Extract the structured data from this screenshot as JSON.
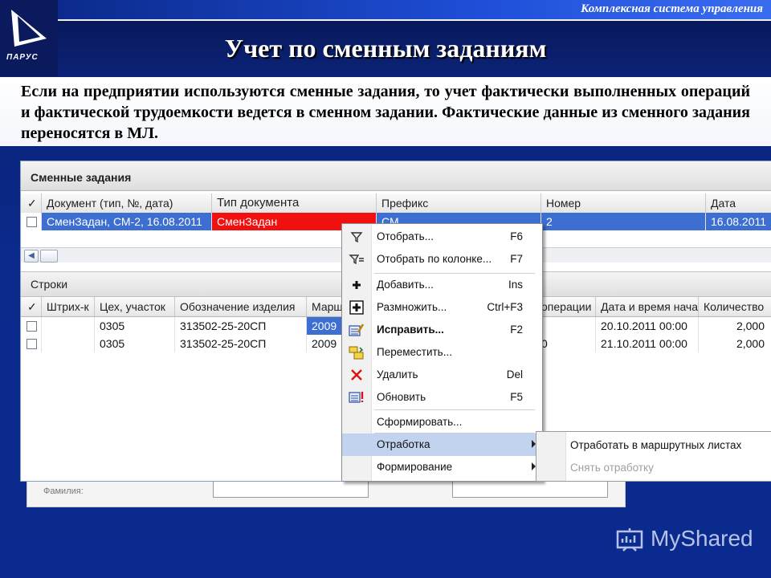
{
  "header": {
    "brand_text": "Комплексная система управления",
    "logo_text": "ПАРУС",
    "title": "Учет по сменным заданиям"
  },
  "intro": {
    "paragraph": "Если на предприятии используются сменные задания, то учет фактически выполненных операций и фактической трудоемкости ведется в сменном задании. Фактические данные из сменного задания переносятся в МЛ."
  },
  "app": {
    "section1_title": "Сменные задания",
    "grid1": {
      "columns": [
        "✓",
        "Документ (тип, №, дата)",
        "Тип документа",
        "Префикс",
        "Номер",
        "Дата"
      ],
      "rows": [
        [
          "",
          "СменЗадан, СМ-2, 16.08.2011",
          "СменЗадан",
          "СМ",
          "2",
          "16.08.2011"
        ]
      ]
    },
    "section2_title": "Строки",
    "grid2": {
      "columns": [
        "✓",
        "Штрих-к",
        "Цех, участок",
        "Обозначение изделия",
        "Марш",
        "операции",
        "Дата и время нача",
        "Количество"
      ],
      "rows": [
        [
          "",
          "",
          "0305",
          "313502-25-20СП",
          "2009",
          "",
          "20.10.2011 00:00",
          "2,000"
        ],
        [
          "",
          "",
          "0305",
          "313502-25-20СП",
          "2009",
          "0",
          "21.10.2011 00:00",
          "2,000"
        ]
      ]
    },
    "footer_label": "Фамилия:"
  },
  "context_menu": {
    "items": [
      {
        "label": "Отобрать...",
        "key": "F6",
        "icon": "filter-icon"
      },
      {
        "label": "Отобрать по колонке...",
        "key": "F7",
        "icon": "filter-column-icon"
      },
      {
        "label": "Добавить...",
        "key": "Ins",
        "icon": "plus-icon"
      },
      {
        "label": "Размножить...",
        "key": "Ctrl+F3",
        "icon": "duplicate-icon"
      },
      {
        "label": "Исправить...",
        "key": "F2",
        "icon": "edit-icon"
      },
      {
        "label": "Переместить...",
        "key": "",
        "icon": "move-icon"
      },
      {
        "label": "Удалить",
        "key": "Del",
        "icon": "delete-icon"
      },
      {
        "label": "Обновить",
        "key": "F5",
        "icon": "refresh-icon"
      },
      {
        "label": "Сформировать...",
        "key": "",
        "icon": ""
      },
      {
        "label": "Отработка",
        "key": "",
        "icon": ""
      },
      {
        "label": "Формирование",
        "key": "",
        "icon": ""
      }
    ],
    "submenu": [
      {
        "label": "Отработать в маршрутных листах",
        "enabled": true
      },
      {
        "label": "Снять отработку",
        "enabled": false
      }
    ]
  },
  "watermark": "MyShared",
  "colors": {
    "background": "#0b2a8c",
    "highlight_red": "#f01010",
    "selection_blue": "#c2d3f0",
    "row_selected": "#3c6fd1"
  }
}
